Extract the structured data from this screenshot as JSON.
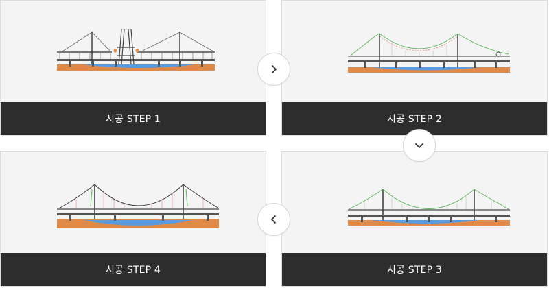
{
  "steps": [
    {
      "label": "시공 STEP 1"
    },
    {
      "label": "시공 STEP 2"
    },
    {
      "label": "시공 STEP 3"
    },
    {
      "label": "시공 STEP 4"
    }
  ],
  "navigation": {
    "next_icon": "chevron-right-icon",
    "down_icon": "chevron-down-icon",
    "prev_icon": "chevron-left-icon"
  },
  "colors": {
    "card_bg": "#f4f4f4",
    "label_bg": "#2d2d2d",
    "label_text": "#ffffff",
    "soil": "#e08a4a",
    "water": "#5a9be0",
    "cable_green": "#5cb85c",
    "cable_red": "#d9534f"
  }
}
